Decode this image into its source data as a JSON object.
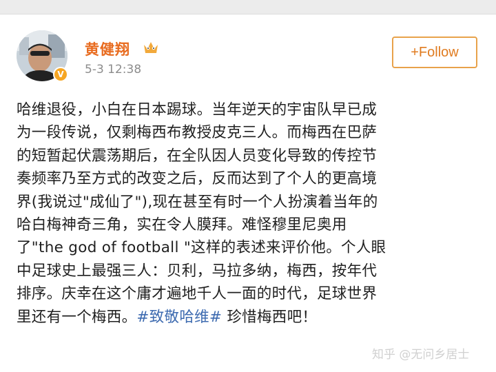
{
  "post": {
    "author": "黄健翔",
    "time": "5-3 12:38",
    "follow_label": "+Follow",
    "badge": "V",
    "lines": [
      "哈维退役，小白在日本踢球。当年逆天的宇宙队早已成",
      "为一段传说，仅剩梅西布教授皮克三人。而梅西在巴萨",
      "的短暂起伏震荡期后，在全队因人员变化导致的传控节",
      "奏频率乃至方式的改变之后，反而达到了个人的更高境",
      "界(我说过\"成仙了\"),现在甚至有时一个人扮演着当年的",
      "哈白梅神奇三角，实在令人膜拜。难怪穆里尼奥用",
      "了\"the god of football \"这样的表述来评价他。个人眼",
      "中足球史上最强三人：贝利，马拉多纳，梅西，按年代",
      "排序。庆幸在这个庸才遍地千人一面的时代，足球世界"
    ],
    "last_line_prefix": "里还有一个梅西。",
    "hashtag": "#致敬哈维#",
    "last_line_suffix": " 珍惜梅西吧！"
  },
  "watermark": "知乎 @无问乡居士",
  "colors": {
    "name": "#e86b1f",
    "follow_border": "#e8a24a",
    "hashtag": "#3e6bb0",
    "time": "#8c8c8c"
  },
  "icons": [
    "avatar",
    "verified-badge-icon",
    "vip-crown-icon"
  ]
}
